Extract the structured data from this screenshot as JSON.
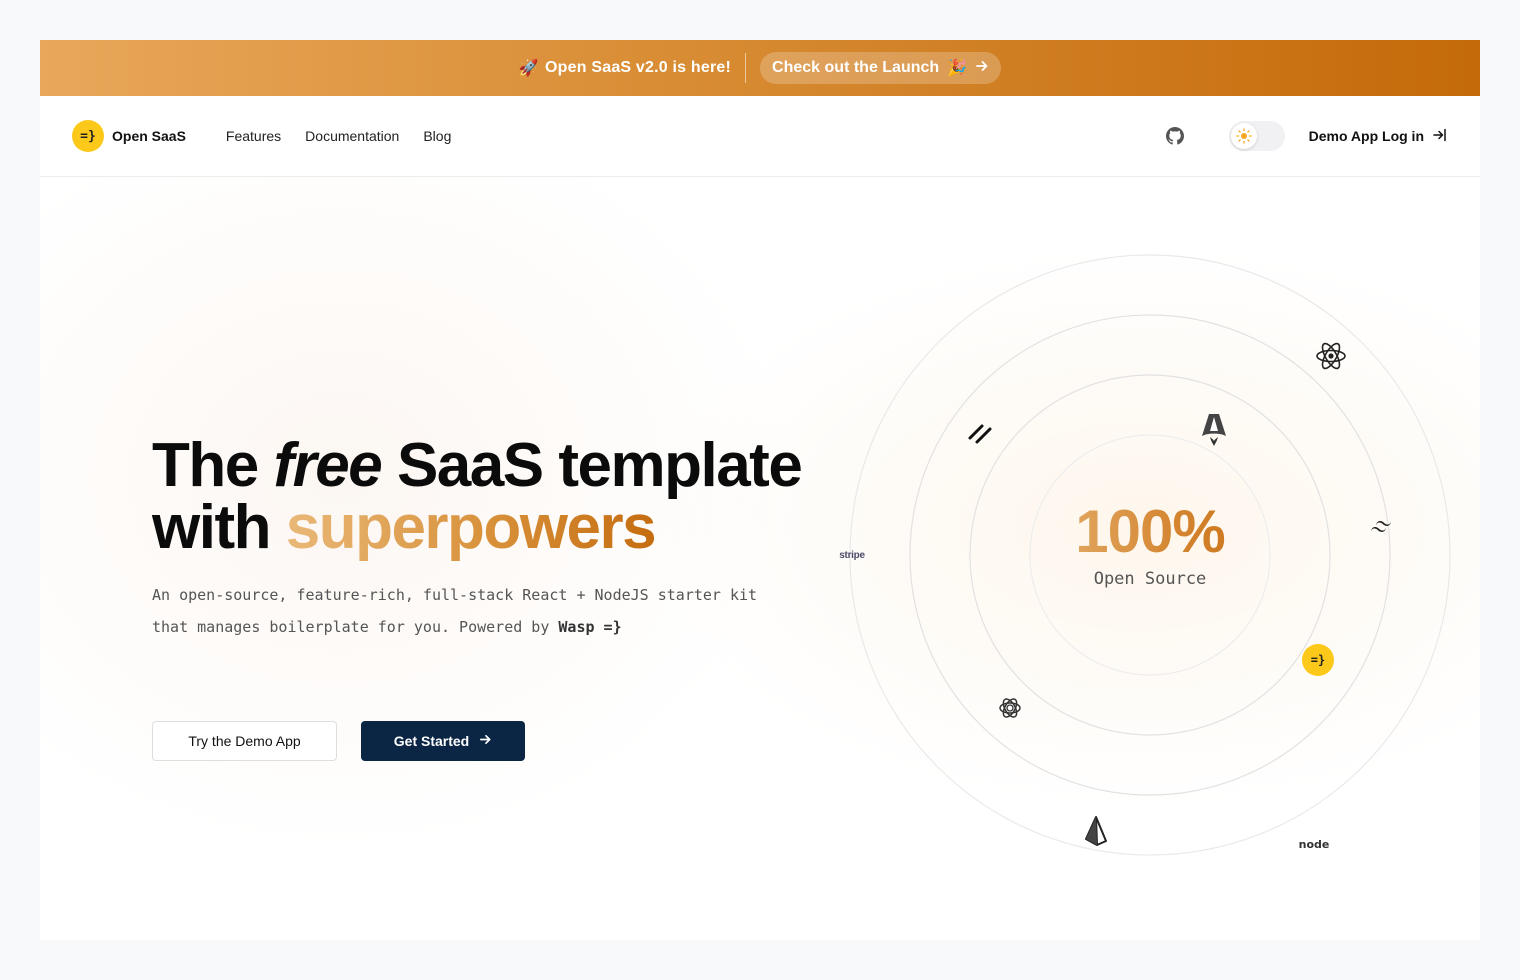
{
  "banner": {
    "message": "Open SaaS v2.0 is here!",
    "rocket_emoji": "🚀",
    "cta_label": "Check out the Launch",
    "cta_emoji": "🎉"
  },
  "nav": {
    "logo_mark": "=}",
    "brand": "Open SaaS",
    "links": [
      "Features",
      "Documentation",
      "Blog"
    ],
    "login_label": "Demo App Log in"
  },
  "hero": {
    "title_part1": "The",
    "title_italic": "free",
    "title_part2": "SaaS template",
    "title_line2_a": "with",
    "title_line2_gradient": "superpowers",
    "subtitle_line1": "An open-source, feature-rich, full-stack React + NodeJS starter kit",
    "subtitle_line2_a": "that manages boilerplate for you. Powered by",
    "subtitle_line2_b": "Wasp =}",
    "btn_demo": "Try the Demo App",
    "btn_start": "Get Started"
  },
  "stat": {
    "value": "100%",
    "label": "Open Source"
  },
  "tech_labels": {
    "stripe": "stripe",
    "node": "node",
    "wasp": "=}"
  },
  "colors": {
    "banner_start": "#e8a75a",
    "banner_end": "#c46a0a",
    "brand_yellow": "#fcc81a",
    "primary_button": "#0b2545",
    "accent_orange": "#d48530"
  },
  "icons": {
    "github": "github-icon",
    "theme": "sun-icon",
    "login": "login-arrow-icon",
    "arrow": "arrow-right-icon"
  }
}
